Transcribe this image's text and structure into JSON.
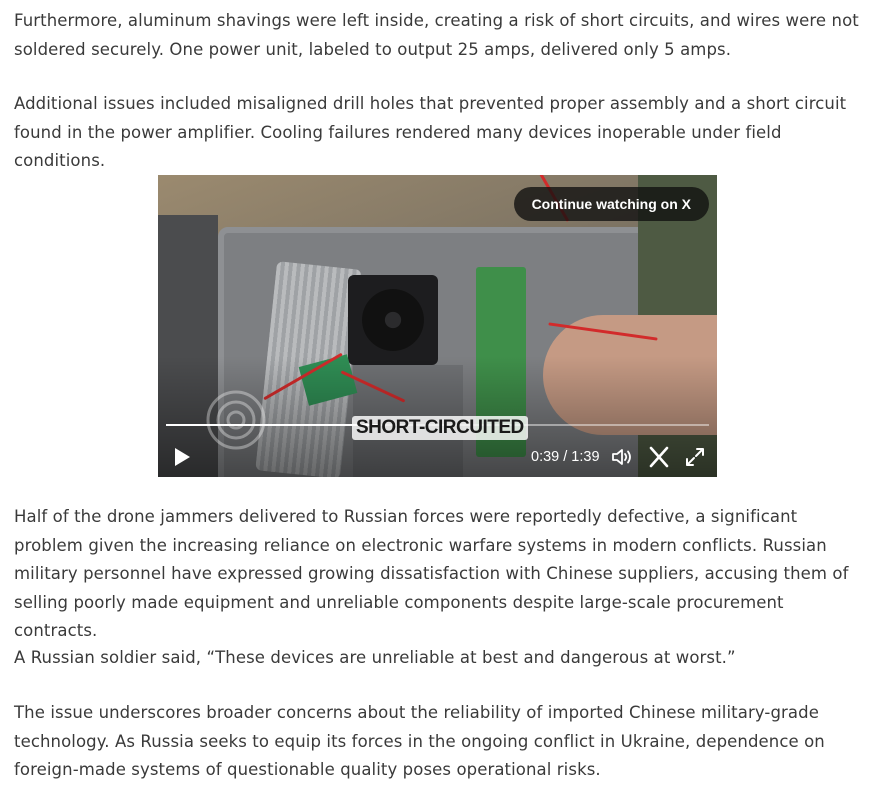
{
  "paragraphs": {
    "p1": "Furthermore, aluminum shavings were left inside, creating a risk of short circuits, and wires were not soldered securely. One power unit, labeled to output 25 amps, delivered only 5 amps.",
    "p2": "Additional issues included misaligned drill holes that prevented proper assembly and a short circuit found in the power amplifier. Cooling failures rendered many devices inoperable under field conditions.",
    "p3": "Half of the drone jammers delivered to Russian forces were reportedly defective, a significant problem given the increasing reliance on electronic warfare systems in modern conflicts. Russian military personnel have expressed growing dissatisfaction with Chinese suppliers, accusing them of selling poorly made equipment and unreliable components despite large-scale procurement contracts.",
    "p4": "A Russian soldier said, “These devices are unreliable at best and dangerous at worst.”",
    "p5": "The issue underscores broader concerns about the reliability of imported Chinese military-grade technology. As Russia seeks to equip its forces in the ongoing conflict in Ukraine, dependence on foreign-made systems of questionable quality poses operational risks."
  },
  "video": {
    "continue_label": "Continue watching on X",
    "caption": "SHORT-CIRCUITED",
    "time_display": "0:39 / 1:39",
    "progress_fraction": 0.39,
    "icons": {
      "play": "play-icon",
      "volume": "volume-icon",
      "x_logo": "x-logo-icon",
      "fullscreen": "fullscreen-icon"
    }
  },
  "colors": {
    "text": "#3a3a3a",
    "overlay": "#0f0f0f",
    "wire": "#d22b2b"
  }
}
